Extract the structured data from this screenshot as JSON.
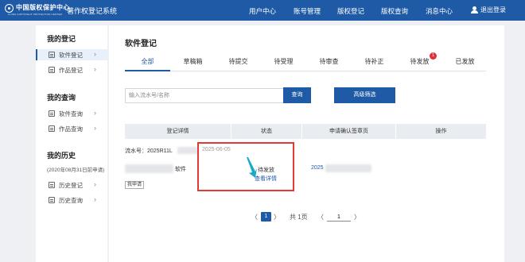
{
  "header": {
    "logo_cn": "中国版权保护中心",
    "logo_en": "CHINA COPYRIGHT PROTECTION CENTER",
    "system_name": "著作权登记系统",
    "nav": [
      "用户中心",
      "账号管理",
      "版权登记",
      "版权查询",
      "消息中心"
    ],
    "logout": "退出登录",
    "bg_color": "#1f5aa6"
  },
  "sidebar": {
    "groups": [
      {
        "title": "我的登记",
        "items": [
          {
            "label": "软件登记",
            "active": true
          },
          {
            "label": "作品登记"
          }
        ]
      },
      {
        "title": "我的查询",
        "items": [
          {
            "label": "软件查询"
          },
          {
            "label": "作品查询"
          }
        ]
      },
      {
        "title": "我的历史",
        "note": "(2020年08月31日前申请)",
        "items": [
          {
            "label": "历史登记"
          },
          {
            "label": "历史查询"
          }
        ]
      }
    ]
  },
  "main": {
    "title": "软件登记",
    "tabs": [
      {
        "label": "全部",
        "active": true
      },
      {
        "label": "草稿箱"
      },
      {
        "label": "待提交"
      },
      {
        "label": "待受理"
      },
      {
        "label": "待审查"
      },
      {
        "label": "待补正"
      },
      {
        "label": "待发放",
        "badge": "1"
      },
      {
        "label": "已发放"
      }
    ],
    "search": {
      "placeholder": "输入流水号/名称",
      "button": "查询",
      "advanced": "高级筛选"
    },
    "table": {
      "columns": [
        "登记详情",
        "状态",
        "申请确认签章页",
        "操作"
      ],
      "rows": [
        {
          "serial": "流水号：2025R11L",
          "date": "2025-06-05",
          "name_suffix": "软件",
          "tag": "我申请",
          "status": "待发放",
          "detail_link": "查看详情",
          "app_no": "2025"
        }
      ]
    },
    "pagination": {
      "prev": "〈",
      "current": "1",
      "next": "〉",
      "total": "共 1页",
      "goto_prev": "〈",
      "goto_value": "1",
      "goto_next": "〉"
    },
    "highlight_color": "#e53935"
  }
}
